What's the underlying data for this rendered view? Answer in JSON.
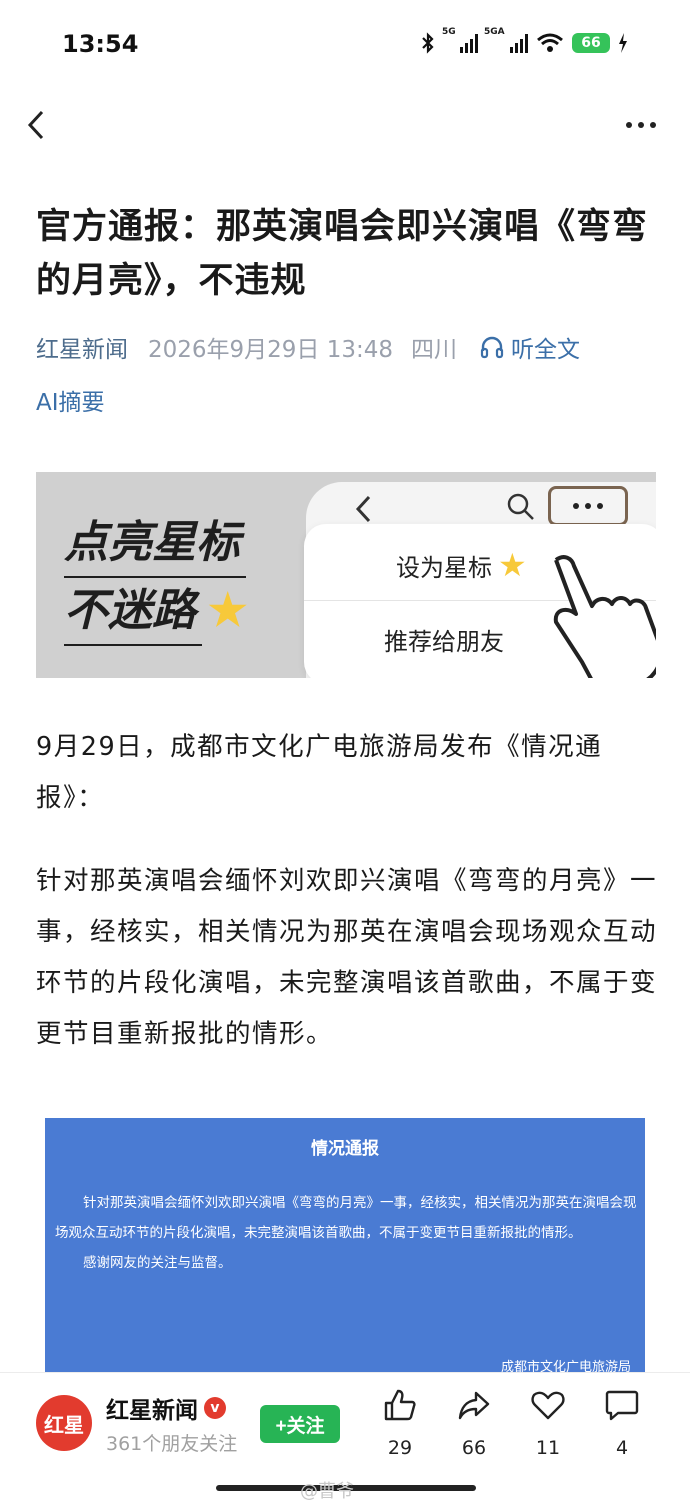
{
  "status_bar": {
    "time": "13:54",
    "signal_1": "5G",
    "signal_2": "5GA",
    "battery": "66"
  },
  "article": {
    "title": "官方通报：那英演唱会即兴演唱《弯弯的月亮》，不违规",
    "source": "红星新闻",
    "date": "2026年9月29日 13:48",
    "location": "四川",
    "listen_label": "听全文",
    "ai_summary": "AI摘要"
  },
  "banner": {
    "slogan_line1": "点亮星标",
    "slogan_line2": "不迷路",
    "menu_item_star": "设为星标",
    "menu_item_recommend": "推荐给朋友"
  },
  "paragraphs": [
    "9月29日，成都市文化广电旅游局发布《情况通报》：",
    "针对那英演唱会缅怀刘欢即兴演唱《弯弯的月亮》一事，经核实，相关情况为那英在演唱会现场观众互动环节的片段化演唱，未完整演唱该首歌曲，不属于变更节目重新报批的情形。"
  ],
  "notice": {
    "title": "情况通报",
    "body_1": "针对那英演唱会缅怀刘欢即兴演唱《弯弯的月亮》一事，经核实，相关情况为那英在演唱会现场观众互动环节的片段化演唱，未完整演唱该首歌曲，不属于变更节目重新报批的情形。",
    "body_2": "感谢网友的关注与监督。",
    "signature": "成都市文化广电旅游局"
  },
  "bottom_bar": {
    "avatar_text": "红星",
    "account_name": "红星新闻",
    "verified_mark": "v",
    "followers": "361个朋友关注",
    "follow_label": "+关注",
    "likes": "29",
    "shares": "66",
    "favorites": "11",
    "comments": "4",
    "watermark": "@曹爷"
  },
  "colors": {
    "accent_blue": "#3b6fa8",
    "notice_blue": "#4a7bd3",
    "follow_green": "#27b455",
    "brand_red": "#e23b2e",
    "battery_green": "#35c35a"
  }
}
